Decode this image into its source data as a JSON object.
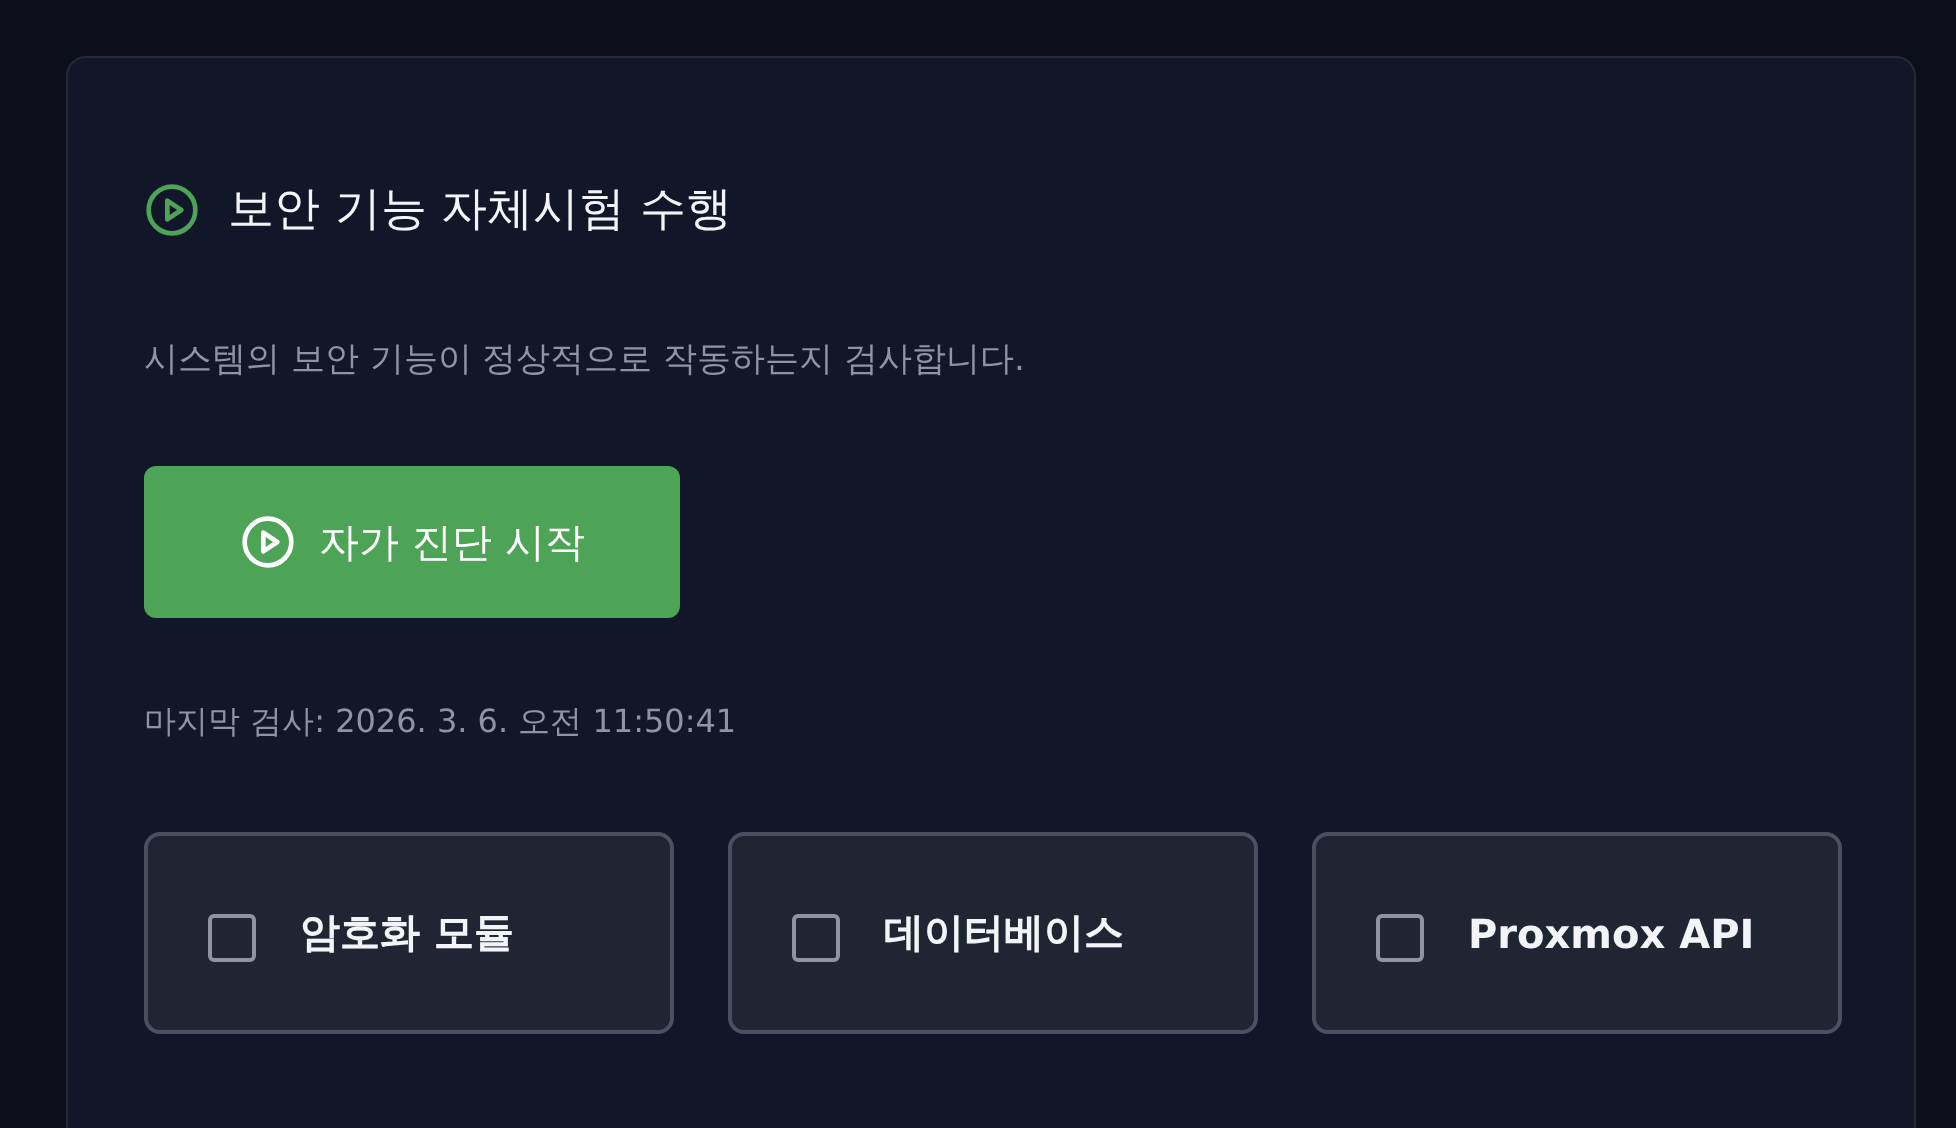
{
  "panel": {
    "title": "보안 기능 자체시험 수행",
    "description": "시스템의 보안 기능이 정상적으로 작동하는지 검사합니다.",
    "start_button": "자가 진단 시작",
    "last_check": "마지막 검사: 2026. 3. 6. 오전 11:50:41",
    "modules": [
      {
        "label": "암호화 모듈",
        "checked": false
      },
      {
        "label": "데이터베이스",
        "checked": false
      },
      {
        "label": "Proxmox API",
        "checked": false
      }
    ]
  }
}
